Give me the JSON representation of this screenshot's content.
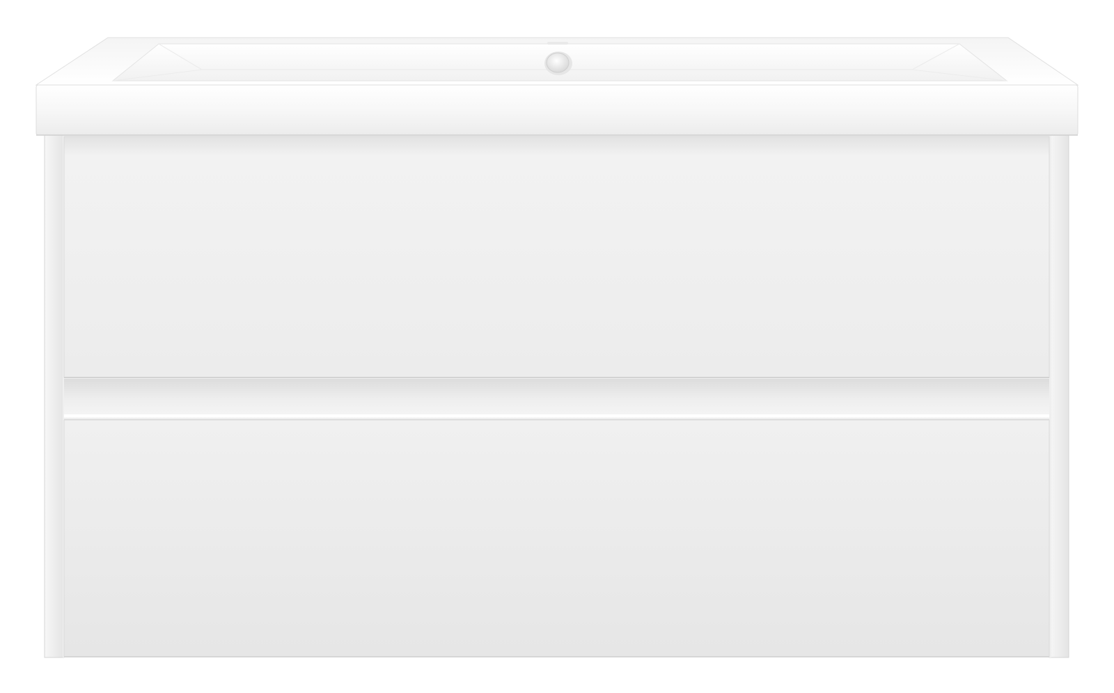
{
  "scene": {
    "subject": "wall-hung-vanity-with-basin",
    "drawer_count": 2,
    "colors": {
      "background": "#ffffff",
      "ceramic_top": "#fbfbfb",
      "ceramic_shadow": "#e9e9e9",
      "cabinet_front": "#ececec",
      "cabinet_edge": "#d6d6d6",
      "overflow_cap": "#eeeeee"
    }
  }
}
